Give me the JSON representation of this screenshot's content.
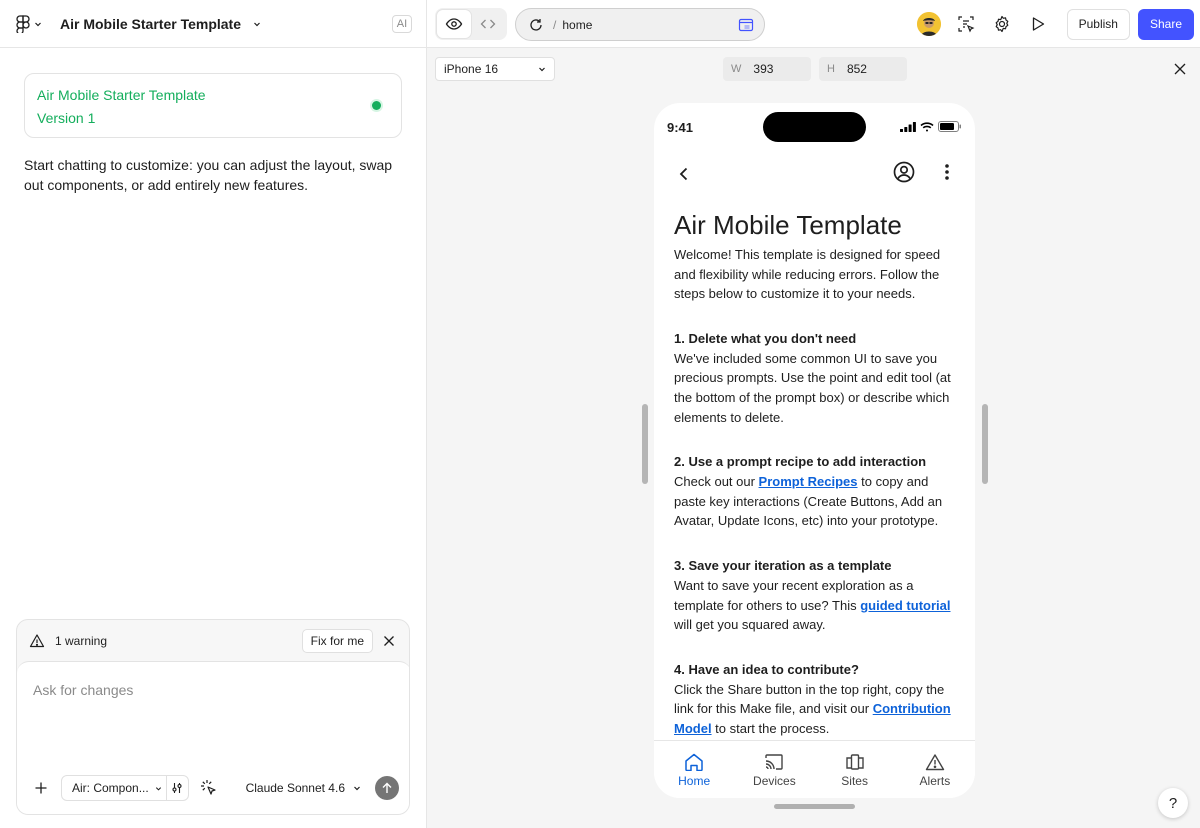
{
  "left": {
    "project_title": "Air Mobile Starter Template",
    "ai_badge": "AI",
    "version_card": {
      "title": "Air Mobile Starter Template",
      "version": "Version 1"
    },
    "intro_text": "Start chatting to customize: you can adjust the layout, swap out components, or add entirely new features.",
    "warning": {
      "text": "1 warning",
      "fix_label": "Fix for me"
    },
    "composer": {
      "placeholder": "Ask for changes",
      "component_chip": "Air: Compon...",
      "model": "Claude Sonnet 4.6"
    }
  },
  "topbar": {
    "url_path": "home",
    "publish_label": "Publish",
    "share_label": "Share"
  },
  "devbar": {
    "device": "iPhone 16",
    "width_label": "W",
    "width_value": "393",
    "height_label": "H",
    "height_value": "852"
  },
  "phone": {
    "time": "9:41",
    "title": "Air Mobile Template",
    "welcome": "Welcome! This template is designed for speed and flexibility while reducing errors. Follow the steps below to customize it to your needs.",
    "sections": [
      {
        "heading": "1. Delete what you don't need",
        "body": "We've included some common UI to save you precious prompts. Use the point and edit tool (at the bottom of the prompt box) or describe which elements to delete."
      },
      {
        "heading": "2. Use a prompt recipe to add interaction",
        "pre": "Check out our ",
        "link": "Prompt Recipes",
        "post": " to copy and paste key interactions (Create Buttons, Add an Avatar, Update Icons, etc) into your prototype."
      },
      {
        "heading": "3. Save your iteration as a template",
        "pre": "Want to save your recent exploration as a template for others to use? This ",
        "link": "guided tutorial",
        "post": " will get you squared away."
      },
      {
        "heading": "4. Have an idea to contribute?",
        "pre": "Click the Share button in the top right, copy the link for this Make file, and visit our ",
        "link": "Contribution Model",
        "post": " to start the process."
      }
    ],
    "tabs": [
      {
        "label": "Home",
        "icon": "home-icon"
      },
      {
        "label": "Devices",
        "icon": "cast-icon"
      },
      {
        "label": "Sites",
        "icon": "sites-icon"
      },
      {
        "label": "Alerts",
        "icon": "alert-icon"
      }
    ]
  },
  "help_label": "?",
  "colors": {
    "accent": "#4353ff",
    "success": "#14ae5c",
    "link": "#0d62d9"
  }
}
